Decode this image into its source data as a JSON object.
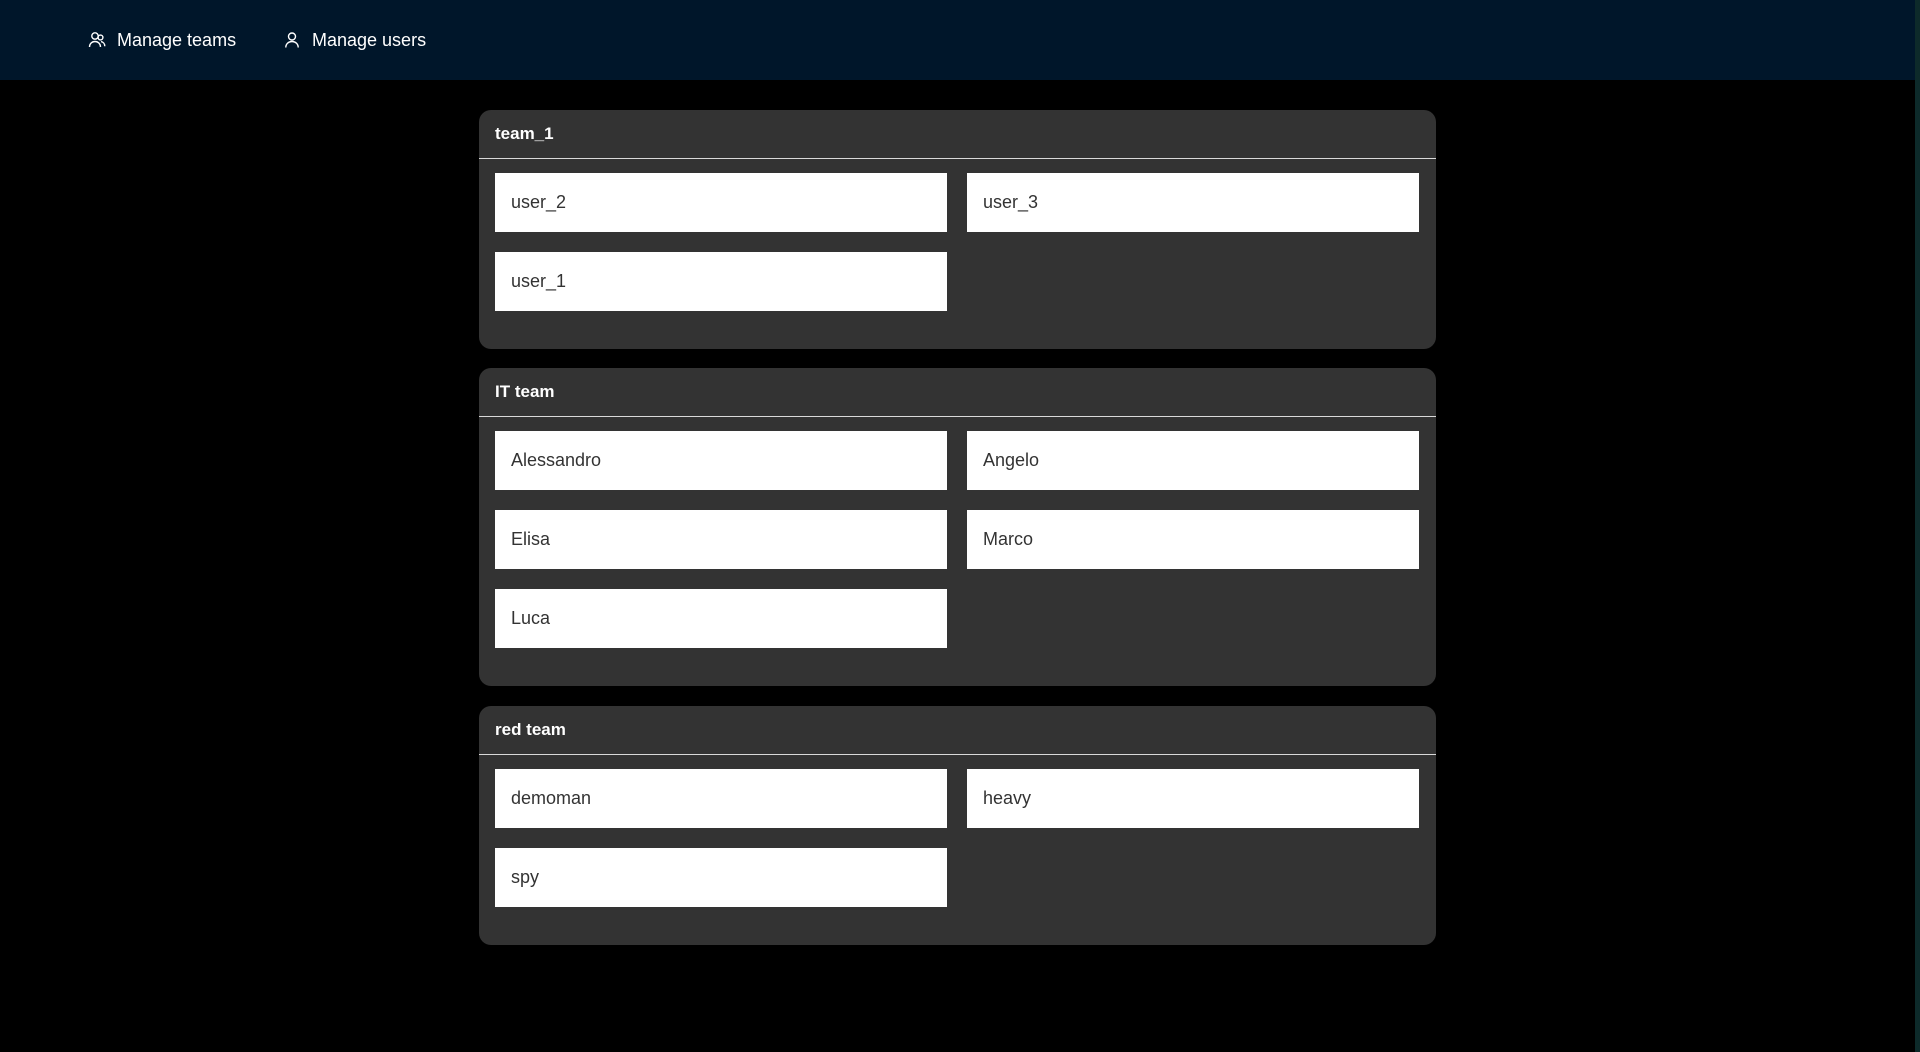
{
  "nav": {
    "manage_teams_label": "Manage teams",
    "manage_teams_icon": "users-icon",
    "manage_users_label": "Manage users",
    "manage_users_icon": "user-icon"
  },
  "colors": {
    "topbar_bg": "#00162a",
    "page_bg": "#000000",
    "card_bg": "#333333",
    "member_bg": "#ffffff"
  },
  "teams": [
    {
      "name": "team_1",
      "members": [
        "user_2",
        "user_3",
        "user_1"
      ]
    },
    {
      "name": "IT team",
      "members": [
        "Alessandro",
        "Angelo",
        "Elisa",
        "Marco",
        "Luca"
      ]
    },
    {
      "name": "red team",
      "members": [
        "demoman",
        "heavy",
        "spy"
      ]
    }
  ]
}
